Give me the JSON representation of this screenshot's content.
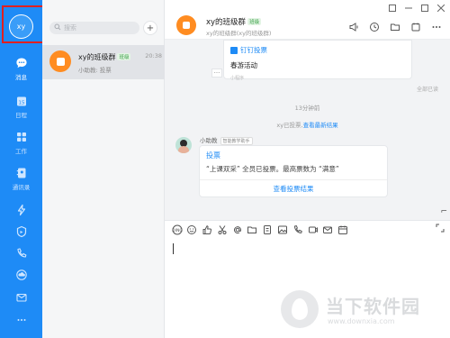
{
  "rail": {
    "avatar_text": "xy",
    "items": [
      {
        "label": "消息",
        "icon": "chat-icon",
        "active": true
      },
      {
        "label": "日程",
        "icon": "calendar-icon",
        "badge": "15"
      },
      {
        "label": "工作",
        "icon": "apps-grid-icon"
      },
      {
        "label": "通讯录",
        "icon": "contacts-icon"
      }
    ],
    "extra_icons": [
      "lightning-icon",
      "shield-icon",
      "phone-icon",
      "cloud-icon",
      "mail-icon",
      "more-dots-icon"
    ]
  },
  "list": {
    "search_placeholder": "搜索",
    "conversations": [
      {
        "name": "xy的班级群",
        "tag": "班级",
        "time": "20:38",
        "preview": "小助教: 投票"
      }
    ]
  },
  "chat": {
    "title": "xy的班级群",
    "title_tag": "班级",
    "subtitle": "xy的班级群(xy的班级群)",
    "top_card": {
      "app": "钉钉投票",
      "text": "春游活动",
      "footer": "小程序"
    },
    "read_status": "全部已读",
    "time_divider": "13分钟前",
    "system_msg": {
      "text": "xy已投票,",
      "link": "查看最新结果"
    },
    "sender": {
      "name": "小助教",
      "role": "智能教学助手"
    },
    "vote_card": {
      "title": "投票",
      "desc": "“上课双采” 全员已投票。最高票数为 “满意”",
      "action": "查看投票结果"
    },
    "toolbar_icons": [
      "ding-icon",
      "emoji-icon",
      "like-icon",
      "scissors-icon",
      "at-icon",
      "folder-icon",
      "doc-icon",
      "image-icon",
      "call-icon",
      "video-icon",
      "mail-icon",
      "calendar-icon"
    ]
  },
  "watermark": {
    "title": "当下软件园",
    "url": "www.downxia.com"
  },
  "colors": {
    "brand": "#1e8bf6",
    "group_logo": "#ff8c21",
    "highlight": "#e02020"
  }
}
